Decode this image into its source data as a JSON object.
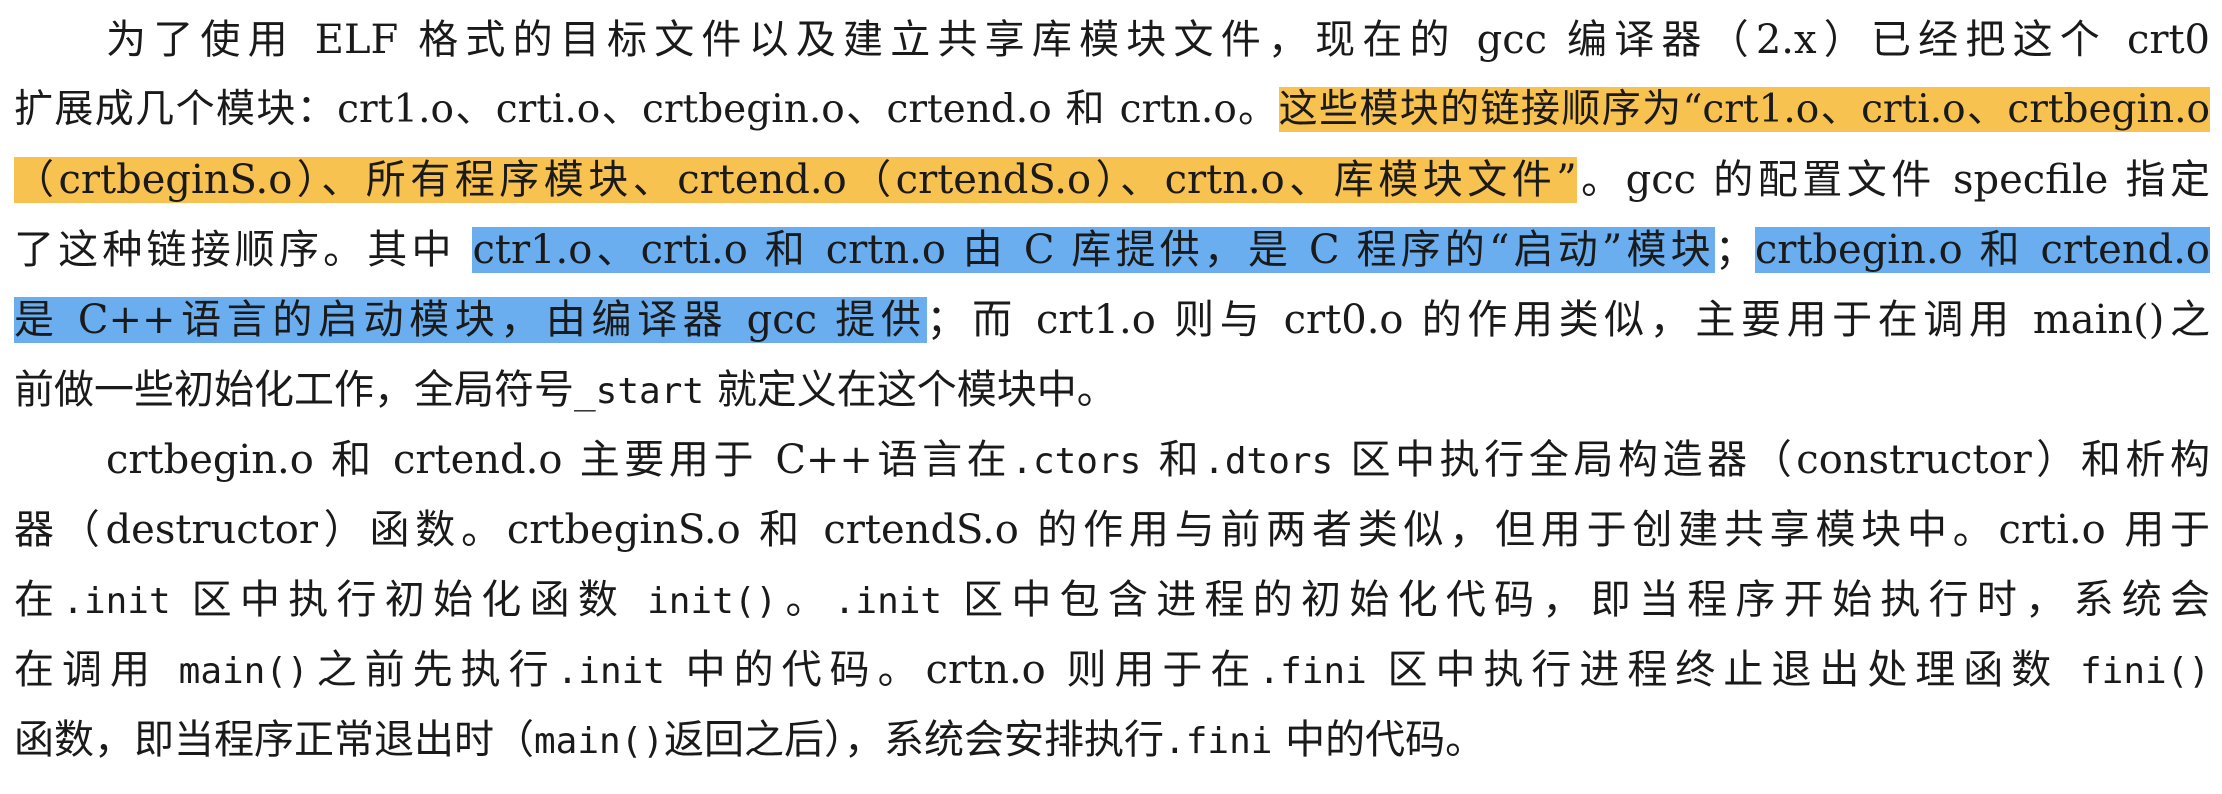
{
  "p1": {
    "l1": "为了使用 ELF 格式的目标文件以及建立共享库模块文件，现在的 gcc 编译器（2.x）已经把这个 crt0",
    "l2a": "扩展成几个模块：crt1.o、crti.o、crtbegin.o、crtend.o 和 crtn.o。",
    "l2b": "这些模块的链接顺序为“crt1.o、crti.o、crtbegin.o",
    "l3a": "（crtbeginS.o）、所有程序模块、crtend.o（crtendS.o）、crtn.o、库模块文件”",
    "l3b": "。gcc 的配置文件 specfile 指定",
    "l4a": "了这种链接顺序。其中 ",
    "l4b": "ctr1.o、crti.o 和 crtn.o 由 C 库提供，是 C 程序的“启动”模块",
    "l4c": "；",
    "l4d": "crtbegin.o 和 crtend.o",
    "l5a": "是 C++语言的启动模块，由编译器 gcc 提供",
    "l5b": "；而 crt1.o 则与 crt0.o 的作用类似，主要用于在调用 main()之",
    "l6a": "前做一些初始化工作，全局符号",
    "l6b": "_start",
    "l6c": " 就定义在这个模块中。"
  },
  "p2": {
    "l1a": "crtbegin.o 和 crtend.o 主要用于 C++语言在",
    "l1b": ".ctors",
    "l1c": " 和",
    "l1d": ".dtors",
    "l1e": " 区中执行全局构造器（constructor）和析构",
    "l2": "器（destructor）函数。crtbeginS.o 和 crtendS.o 的作用与前两者类似，但用于创建共享模块中。crti.o 用于",
    "l3a": "在",
    "l3b": ".init",
    "l3c": " 区中执行初始化函数 ",
    "l3d": "init()",
    "l3e": "。",
    "l3f": ".init",
    "l3g": " 区中包含进程的初始化代码，即当程序开始执行时，系统会",
    "l4a": "在调用 ",
    "l4b": "main()",
    "l4c": "之前先执行",
    "l4d": ".init",
    "l4e": " 中的代码。crtn.o 则用于在",
    "l4f": ".fini",
    "l4g": " 区中执行进程终止退出处理函数 ",
    "l4h": "fini()",
    "l5a": "函数，即当程序正常退出时（",
    "l5b": "main()",
    "l5c": "返回之后），系统会安排执行",
    "l5d": ".fini",
    "l5e": " 中的代码。"
  },
  "colors": {
    "highlight_orange": "#f7c250",
    "highlight_blue": "#6aaef0",
    "text": "#1a1a1a"
  }
}
